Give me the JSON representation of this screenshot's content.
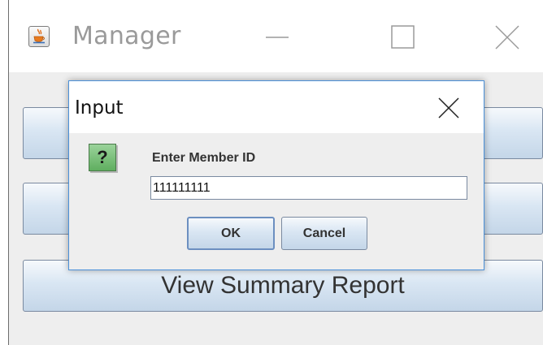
{
  "main_window": {
    "title": "Manager",
    "buttons": [
      "",
      "",
      "View Summary Report"
    ]
  },
  "dialog": {
    "title": "Input",
    "prompt": "Enter Member ID",
    "input_value": "111111111",
    "ok_label": "OK",
    "cancel_label": "Cancel",
    "icon_glyph": "?"
  },
  "icons": {
    "app": "java-cup-icon",
    "minimize": "minimize-icon",
    "maximize": "maximize-icon",
    "close": "close-icon",
    "dialog_type": "question-icon"
  },
  "colors": {
    "dialog_border": "#4a90d9",
    "question_icon": "#5fae5f",
    "button_gradient_bottom": "#c4d6e8"
  }
}
